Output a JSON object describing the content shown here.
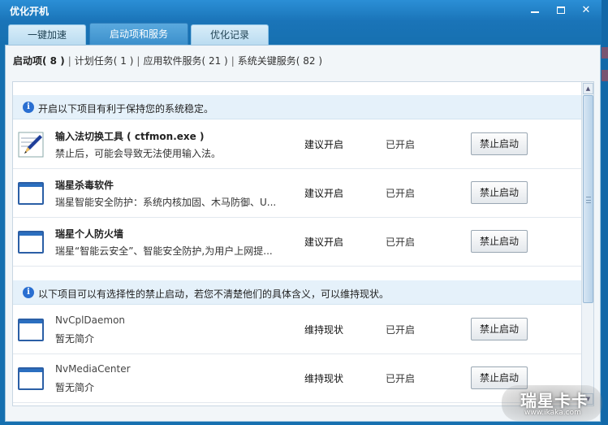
{
  "window": {
    "title": "优化开机",
    "minimize_icon": "minimize-icon",
    "maximize_icon": "maximize-icon",
    "close_icon": "close-icon"
  },
  "tabs": [
    {
      "label": "一键加速",
      "active": false
    },
    {
      "label": "启动项和服务",
      "active": true
    },
    {
      "label": "优化记录",
      "active": false
    }
  ],
  "filters": [
    {
      "label": "启动项",
      "count": "( 8 )",
      "selected": true
    },
    {
      "label": "计划任务",
      "count": "( 1 )",
      "selected": false
    },
    {
      "label": "应用软件服务",
      "count": "( 21 )",
      "selected": false
    },
    {
      "label": "系统关键服务",
      "count": "( 82 )",
      "selected": false
    }
  ],
  "filter_separator": "|",
  "sections": [
    {
      "info": "开启以下项目有利于保持您的系统稳定。",
      "items": [
        {
          "name": "输入法切换工具 ( ctfmon.exe )",
          "desc": "禁止后，可能会导致无法使用输入法。",
          "recommendation": "建议开启",
          "status": "已开启",
          "action": "禁止启动",
          "icon": "pen-app-icon"
        },
        {
          "name": "瑞星杀毒软件",
          "desc": "瑞星智能安全防护：系统内核加固、木马防御、U...",
          "recommendation": "建议开启",
          "status": "已开启",
          "action": "禁止启动",
          "icon": "window-app-icon"
        },
        {
          "name": "瑞星个人防火墙",
          "desc": "瑞星“智能云安全”、智能安全防护,为用户上网提...",
          "recommendation": "建议开启",
          "status": "已开启",
          "action": "禁止启动",
          "icon": "window-app-icon"
        }
      ]
    },
    {
      "info": "以下项目可以有选择性的禁止启动，若您不清楚他们的具体含义，可以维持现状。",
      "items": [
        {
          "name": "NvCplDaemon",
          "desc": "暂无简介",
          "recommendation": "维持现状",
          "status": "已开启",
          "action": "禁止启动",
          "icon": "window-app-icon"
        },
        {
          "name": "NvMediaCenter",
          "desc": "暂无简介",
          "recommendation": "维持现状",
          "status": "已开启",
          "action": "禁止启动",
          "icon": "window-app-icon"
        }
      ]
    }
  ],
  "watermark": {
    "brand": "瑞星卡卡",
    "url": "www.ikaka.com"
  },
  "colors": {
    "title_bar": "#1a74b8",
    "active_tab": "#3b8fcb",
    "info_band": "#e5f1fa"
  }
}
